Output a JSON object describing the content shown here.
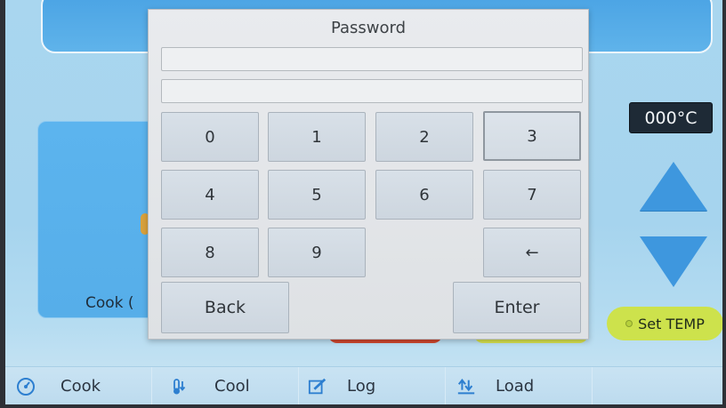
{
  "dialog": {
    "title": "Password",
    "field1_value": "",
    "field2_value": "",
    "keys": [
      "0",
      "1",
      "2",
      "3",
      "4",
      "5",
      "6",
      "7",
      "8",
      "9",
      "←"
    ],
    "back_label": "Back",
    "enter_label": "Enter"
  },
  "background": {
    "cook_card_label": "Cook (",
    "temperature": "000°C",
    "set_temp_label": "Set TEMP"
  },
  "bottom_nav": {
    "items": [
      {
        "label": "Cook",
        "icon": "gauge-icon"
      },
      {
        "label": "Cool",
        "icon": "thermometer-icon"
      },
      {
        "label": "Log",
        "icon": "edit-icon"
      },
      {
        "label": "Load",
        "icon": "load-arrows-icon"
      }
    ]
  },
  "colors": {
    "screen_bg": "#a9d6ef",
    "dialog_bg": "#e9ebee",
    "key_bg": "#d8e0e8",
    "temp_display_bg": "#1e2a36",
    "set_temp_bg": "#cde24c",
    "arrow_blue": "#3e97de"
  }
}
